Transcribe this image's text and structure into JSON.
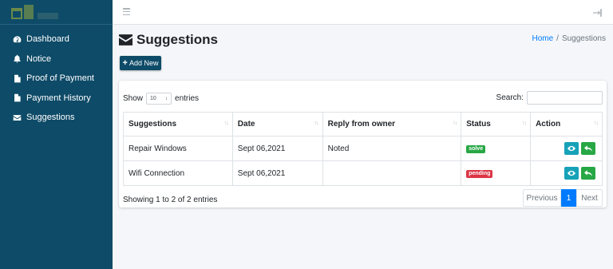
{
  "sidebar": {
    "items": [
      {
        "label": "Dashboard",
        "icon": "dashboard-gauge-icon"
      },
      {
        "label": "Notice",
        "icon": "bell-icon"
      },
      {
        "label": "Proof of Payment",
        "icon": "file-icon"
      },
      {
        "label": "Payment History",
        "icon": "file-icon"
      },
      {
        "label": "Suggestions",
        "icon": "envelope-icon"
      }
    ]
  },
  "header": {
    "title": "Suggestions",
    "breadcrumb": {
      "home": "Home",
      "separator": "/",
      "current": "Suggestions"
    }
  },
  "toolbar": {
    "add_label": "Add New",
    "add_icon": "+"
  },
  "table_controls": {
    "show_label": "Show",
    "entries_value": "10",
    "entries_label": "entries",
    "search_label": "Search:",
    "search_value": ""
  },
  "table": {
    "columns": [
      "Suggestions",
      "Date",
      "Reply from owner",
      "Status",
      "Action"
    ],
    "rows": [
      {
        "suggestion": "Repair Windows",
        "date": "Sept 06,2021",
        "reply": "Noted",
        "status": "solve",
        "status_color": "#28a745"
      },
      {
        "suggestion": "Wifi Connection",
        "date": "Sept 06,2021",
        "reply": "",
        "status": "pending",
        "status_color": "#dc3545"
      }
    ]
  },
  "footer": {
    "info": "Showing 1 to 2 of 2 entries",
    "previous": "Previous",
    "current_page": "1",
    "next": "Next"
  },
  "colors": {
    "sidebar": "#0e4b68",
    "primary": "#007bff",
    "info": "#17a2b8",
    "success": "#28a745",
    "danger": "#dc3545"
  }
}
